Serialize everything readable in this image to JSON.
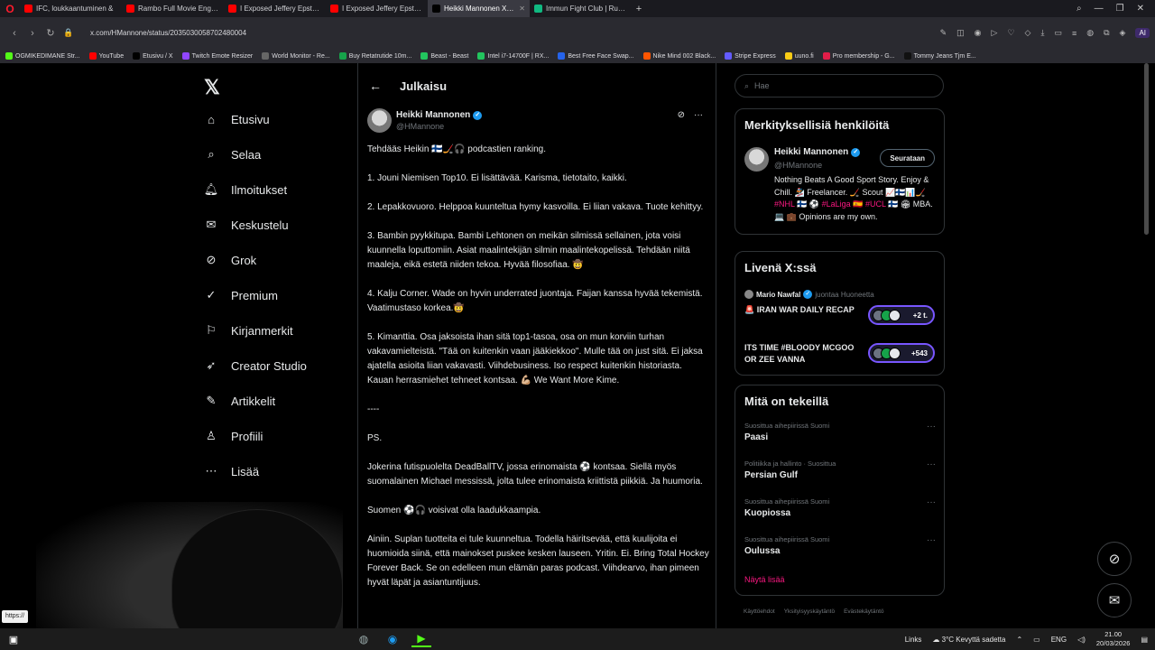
{
  "browser": {
    "tabs": [
      {
        "label": "IFC, loukkaantuminen &",
        "color": "#ff0000"
      },
      {
        "label": "Rambo Full Movie English",
        "color": "#ff0000"
      },
      {
        "label": "I Exposed Jeffery Epstein's",
        "color": "#ff0000"
      },
      {
        "label": "I Exposed Jeffery Epstein's",
        "color": "#ff0000"
      },
      {
        "label": "Heikki Mannonen X:ssä: \"",
        "color": "#000000",
        "active": true
      },
      {
        "label": "Immun Fight Club | Ruutu",
        "color": "#10b981"
      }
    ],
    "url": "x.com/HMannone/status/2035030058702480004",
    "bookmarks": [
      {
        "label": "OGMIKEDIMANE Str...",
        "color": "#53fc18"
      },
      {
        "label": "YouTube",
        "color": "#ff0000"
      },
      {
        "label": "Etusivu / X",
        "color": "#000000"
      },
      {
        "label": "Twitch Emote Resizer",
        "color": "#9146ff"
      },
      {
        "label": "World Monitor - Re...",
        "color": "#666666"
      },
      {
        "label": "Buy Retatrutide 10m...",
        "color": "#16a34a"
      },
      {
        "label": "Beast - Beast",
        "color": "#22c55e"
      },
      {
        "label": "Intel i7-14700F | RX...",
        "color": "#22c55e"
      },
      {
        "label": "Best Free Face Swap...",
        "color": "#2563eb"
      },
      {
        "label": "Nike Mind 002 Black...",
        "color": "#ff5500"
      },
      {
        "label": "Stripe Express",
        "color": "#635bff"
      },
      {
        "label": "uuno.fi",
        "color": "#facc15"
      },
      {
        "label": "Pro membership - G...",
        "color": "#e11d48"
      },
      {
        "label": "Tommy Jeans Tjm E...",
        "color": "#111111"
      }
    ],
    "ai_label": "AI"
  },
  "nav": {
    "items": [
      {
        "label": "Etusivu",
        "icon": "home-icon"
      },
      {
        "label": "Selaa",
        "icon": "search-icon"
      },
      {
        "label": "Ilmoitukset",
        "icon": "bell-icon"
      },
      {
        "label": "Keskustelu",
        "icon": "mail-icon"
      },
      {
        "label": "Grok",
        "icon": "grok-icon"
      },
      {
        "label": "Premium",
        "icon": "premium-icon"
      },
      {
        "label": "Kirjanmerkit",
        "icon": "bookmark-icon"
      },
      {
        "label": "Creator Studio",
        "icon": "rocket-icon"
      },
      {
        "label": "Artikkelit",
        "icon": "article-icon"
      },
      {
        "label": "Profiili",
        "icon": "profile-icon"
      },
      {
        "label": "Lisää",
        "icon": "more-icon"
      }
    ]
  },
  "main": {
    "header_title": "Julkaisu",
    "author_name": "Heikki Mannonen",
    "author_handle": "@HMannone",
    "post": [
      "Tehdääs Heikin 🇫🇮🏒🎧 podcastien ranking.",
      "1. Jouni Niemisen Top10. Ei lisättävää. Karisma, tietotaito, kaikki.",
      "2. Lepakkovuoro. Helppoa kuunteltua hymy kasvoilla. Ei liian vakava. Tuote kehittyy.",
      "3. Bambin pyykkitupa. Bambi Lehtonen on meikän silmissä sellainen, jota voisi kuunnella loputtomiin. Asiat maalintekijän silmin maalintekopelissä. Tehdään niitä maaleja, eikä estetä niiden tekoa. Hyvää filosofiaa. 🤠",
      "4. Kalju Corner. Wade on hyvin underrated juontaja. Faijan kanssa hyvää tekemistä. Vaatimustaso korkea.🤠",
      "5. Kimanttia. Osa jaksoista ihan sitä top1-tasoa, osa on mun korviin turhan vakavamielteistä. \"Tää on kuitenkin vaan jääkiekkoo\". Mulle tää on just sitä. Ei jaksa ajatella asioita liian vakavasti. Viihdebusiness. Iso respect kuitenkin historiasta. Kauan herrasmiehet tehneet kontsaa. 💪🏼 We Want More Kime.",
      "----",
      "PS.",
      "Jokerina futispuolelta DeadBallTV, jossa erinomaista ⚽ kontsaa. Siellä myös suomalainen Michael messissä, jolta tulee erinomaista kriittistä piikkiä. Ja huumoria.",
      "Suomen ⚽🎧 voisivat olla laadukkaampia.",
      "Ainiin. Suplan tuotteita ei tule kuunneltua. Todella häiritsevää, että kuulijoita ei huomioida siinä, että mainokset puskee kesken lauseen. Yritin. Ei. Bring Total Hockey Forever Back. Se on edelleen mun elämän paras podcast. Viihdearvo, ihan pimeen hyvät läpät ja asiantuntijuus."
    ]
  },
  "right": {
    "search_placeholder": "Hae",
    "who_title": "Merkityksellisiä henkilöitä",
    "who_name": "Heikki Mannonen",
    "who_handle": "@HMannone",
    "who_follow": "Seurataan",
    "who_bio_1": "Nothing Beats A Good Sport Story. Enjoy & Chill. 🏂 Freelancer. 🏒 Scout 📈🇫🇮📊🏒",
    "who_bio_tag1": "#NHL",
    "who_bio_mid": "🇫🇮 ⚽",
    "who_bio_tag2": "#LaLiga",
    "who_bio_mid2": "🇪🇸",
    "who_bio_tag3": "#UCL",
    "who_bio_end": "🇫🇮 🏟 MBA. 💻 💼 Opinions are my own.",
    "live_title": "Livenä X:ssä",
    "live_host": "Mario Nawfal",
    "live_host_suffix": "juontaa Huoneetta",
    "live_items": [
      {
        "label": "🚨 IRAN WAR DAILY RECAP",
        "badge": "+2 t."
      },
      {
        "label": "ITS TIME #BLOODY MCGOO OR ZEE VANNA",
        "badge": "+543"
      }
    ],
    "trends_title": "Mitä on tekeillä",
    "trends": [
      {
        "context": "Suosittua aihepiirissä Suomi",
        "name": "Paasi"
      },
      {
        "context": "Politiikka ja hallinto · Suosittua",
        "name": "Persian Gulf"
      },
      {
        "context": "Suosittua aihepiirissä Suomi",
        "name": "Kuopiossa"
      },
      {
        "context": "Suosittua aihepiirissä Suomi",
        "name": "Oulussa"
      }
    ],
    "show_more": "Näytä lisää",
    "footer": [
      "Käyttöehdot",
      "Yksityisyyskäytäntö",
      "Evästekäytäntö"
    ]
  },
  "overlay": {
    "tooltip": "https://"
  },
  "taskbar": {
    "links_label": "Links",
    "weather": "3°C Kevyttä sadetta",
    "lang": "ENG",
    "time": "21.00",
    "date": "20/03/2026"
  }
}
